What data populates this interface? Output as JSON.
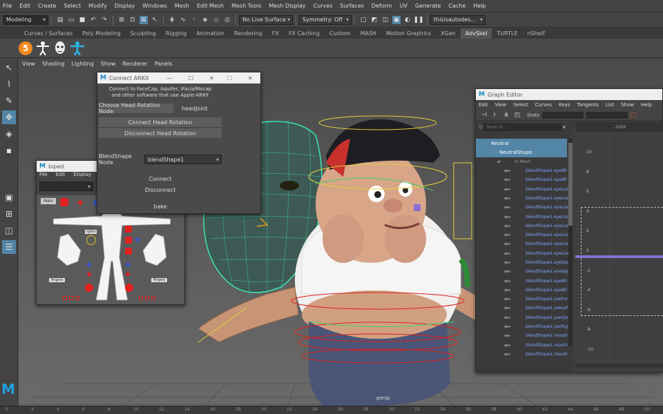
{
  "menu": [
    "File",
    "Edit",
    "Create",
    "Select",
    "Modify",
    "Display",
    "Windows",
    "Mesh",
    "Edit Mesh",
    "Mesh Tools",
    "Mesh Display",
    "Curves",
    "Surfaces",
    "Deform",
    "UV",
    "Generate",
    "Cache",
    "Help"
  ],
  "status": {
    "mode": "Modeling",
    "live_surface": "No Live Surface",
    "symmetry": "Symmetry: Off",
    "user": "thisisautodes..."
  },
  "shelf_tabs": [
    "Curves / Surfaces",
    "Poly Modeling",
    "Sculpting",
    "Rigging",
    "Animation",
    "Rendering",
    "FX",
    "FX Caching",
    "Custom",
    "MASH",
    "Motion Graphics",
    "XGen",
    "AdvSkel",
    "TURTLE",
    "nShelf"
  ],
  "active_shelf": "AdvSkel",
  "shelf_badge": "5",
  "viewport_menu": [
    "View",
    "Shading",
    "Lighting",
    "Show",
    "Renderer",
    "Panels"
  ],
  "camera_label": "persp",
  "arkit": {
    "title": "Connect ARKit",
    "description": "Connect to FaceCap, Aquifer, iFacialMocap and other software that use Apple-ARKit",
    "choose_label": "Choose Head Rotation Node",
    "head_node": "headJoint",
    "connect_head": "Connect Head Rotation",
    "disconnect_head": "Disconnect Head Rotation",
    "blend_label": "BlendShape Node",
    "blend_value": "blendShape1",
    "connect": "Connect",
    "disconnect": "Disconnect",
    "bake": "bake"
  },
  "biped": {
    "title": "biped",
    "menu": [
      "File",
      "Edit",
      "Display",
      "View"
    ],
    "main_label": "Main",
    "spine_label": "spine",
    "fingers_left": "fingers",
    "fingers_right": "fingers"
  },
  "graph": {
    "title": "Graph Editor",
    "menu": [
      "Edit",
      "View",
      "Select",
      "Curves",
      "Keys",
      "Tangents",
      "List",
      "Show",
      "Help"
    ],
    "stats_label": "Stats",
    "search_placeholder": "Search...",
    "ruler_value": "-1000",
    "outliner": [
      {
        "label": "Neutral",
        "indent": 0,
        "selected": true
      },
      {
        "label": "NeutralShape",
        "indent": 1,
        "selected": true
      },
      {
        "label": "In Mesh",
        "indent": 2,
        "selected": false
      },
      {
        "label": "blendShape1.eyeBli",
        "indent": 3
      },
      {
        "label": "blendShape1.eyeBli",
        "indent": 3
      },
      {
        "label": "blendShape1.eyeLoo",
        "indent": 3
      },
      {
        "label": "blendShape1.eyeLoo",
        "indent": 3
      },
      {
        "label": "blendShape1.eyeLoo",
        "indent": 3
      },
      {
        "label": "blendShape1.eyeLoo",
        "indent": 3
      },
      {
        "label": "blendShape1.eyeLoo",
        "indent": 3
      },
      {
        "label": "blendShape1.eyeLoo",
        "indent": 3
      },
      {
        "label": "blendShape1.eyeLoo",
        "indent": 3
      },
      {
        "label": "blendShape1.eyeLoo",
        "indent": 3
      },
      {
        "label": "blendShape1.eyeSqu",
        "indent": 3
      },
      {
        "label": "blendShape1.eyeSqu",
        "indent": 3
      },
      {
        "label": "blendShape1.eyeWi",
        "indent": 3
      },
      {
        "label": "blendShape1.eyeWi",
        "indent": 3
      },
      {
        "label": "blendShape1.jawFor",
        "indent": 3
      },
      {
        "label": "blendShape1.jawLef",
        "indent": 3
      },
      {
        "label": "blendShape1.jawOpe",
        "indent": 3
      },
      {
        "label": "blendShape1.jawRig",
        "indent": 3
      },
      {
        "label": "blendShape1.mouth",
        "indent": 3
      },
      {
        "label": "blendShape1.mouth",
        "indent": 3
      },
      {
        "label": "blendShape1.mouth",
        "indent": 3
      }
    ],
    "y_ticks": [
      "10",
      "8",
      "6",
      "4",
      "2",
      "0",
      "-2",
      "-4",
      "-6",
      "-8",
      "-10"
    ]
  },
  "timeline_ticks": [
    "0",
    "2",
    "4",
    "6",
    "8",
    "10",
    "12",
    "14",
    "16",
    "18",
    "20",
    "22",
    "24",
    "26",
    "28",
    "30",
    "32",
    "34",
    "36",
    "38",
    "40",
    "42",
    "44",
    "46",
    "48",
    "50"
  ]
}
